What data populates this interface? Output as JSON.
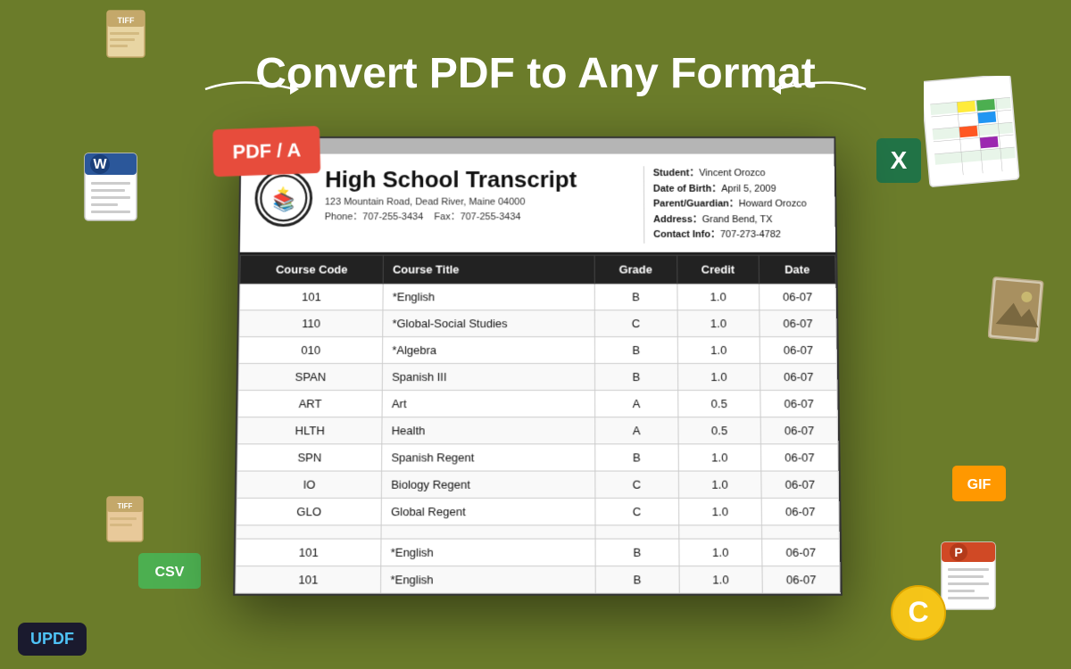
{
  "page": {
    "title": "Convert PDF to Any Format",
    "background_color": "#6b7c2a"
  },
  "logo": {
    "text": "UPDF"
  },
  "pdf_badge": {
    "text": "PDF / A"
  },
  "transcript": {
    "title": "High School Transcript",
    "address": "123 Mountain Road, Dead River, Maine 04000",
    "phone": "Phone：707-255-3434",
    "fax": "Fax：707-255-3434",
    "student": {
      "name_label": "Student：",
      "name": "Vincent Orozco",
      "dob_label": "Date of Birth：",
      "dob": "April 5,  2009",
      "guardian_label": "Parent/Guardian：",
      "guardian": "Howard Orozco",
      "address_label": "Address：",
      "address": "Grand Bend, TX",
      "contact_label": "Contact Info：",
      "contact": "707-273-4782"
    },
    "table": {
      "headers": [
        "Course Code",
        "Course Title",
        "Grade",
        "Credit",
        "Date"
      ],
      "rows": [
        [
          "101",
          "*English",
          "B",
          "1.0",
          "06-07"
        ],
        [
          "110",
          "*Global-Social Studies",
          "C",
          "1.0",
          "06-07"
        ],
        [
          "010",
          "*Algebra",
          "B",
          "1.0",
          "06-07"
        ],
        [
          "SPAN",
          "Spanish III",
          "B",
          "1.0",
          "06-07"
        ],
        [
          "ART",
          "Art",
          "A",
          "0.5",
          "06-07"
        ],
        [
          "HLTH",
          "Health",
          "A",
          "0.5",
          "06-07"
        ],
        [
          "SPN",
          "Spanish Regent",
          "B",
          "1.0",
          "06-07"
        ],
        [
          "IO",
          "Biology Regent",
          "C",
          "1.0",
          "06-07"
        ],
        [
          "GLO",
          "Global Regent",
          "C",
          "1.0",
          "06-07"
        ],
        [
          "",
          "",
          "",
          "",
          ""
        ],
        [
          "101",
          "*English",
          "B",
          "1.0",
          "06-07"
        ],
        [
          "101",
          "*English",
          "B",
          "1.0",
          "06-07"
        ]
      ]
    }
  },
  "icons": {
    "tiff_top": "TIFF",
    "tiff_bottom": "TIFF",
    "word": "W",
    "csv": "CSV",
    "excel": "X",
    "spreadsheet": "spreadsheet",
    "gif": "GIF",
    "ppt": "P",
    "c": "C",
    "photo": "photo"
  }
}
